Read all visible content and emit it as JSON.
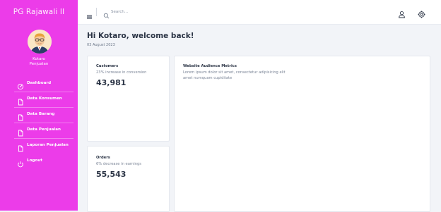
{
  "sidebar": {
    "brand": "PG Rajawali II",
    "user": {
      "name": "Kotaro",
      "role": "Penjualan"
    },
    "items": [
      {
        "label": "Dashboard",
        "icon": "dashboard-icon"
      },
      {
        "label": "Data Konsumen",
        "icon": "document-icon"
      },
      {
        "label": "Data Barang",
        "icon": "document-icon"
      },
      {
        "label": "Data Penjualan",
        "icon": "document-icon"
      },
      {
        "label": "Laporan Penjualan",
        "icon": "document-icon"
      },
      {
        "label": "Logout",
        "icon": "power-icon"
      }
    ],
    "color": "#ec3ce9"
  },
  "topbar": {
    "search_placeholder": "Search..."
  },
  "main": {
    "greeting": "Hi Kotaro, welcome back!",
    "date": "03 August 2023",
    "cards": {
      "customers": {
        "title": "Customers",
        "subtitle": "23% increase in conversion",
        "value": "43,981"
      },
      "orders": {
        "title": "Orders",
        "subtitle": "6% decrease in earnings",
        "value": "55,543"
      },
      "audience": {
        "title": "Website Audience Metrics",
        "description": "Lorem ipsum dolor sit amet, consectetur adipisicing elit amet numquam cupiditate"
      }
    }
  }
}
